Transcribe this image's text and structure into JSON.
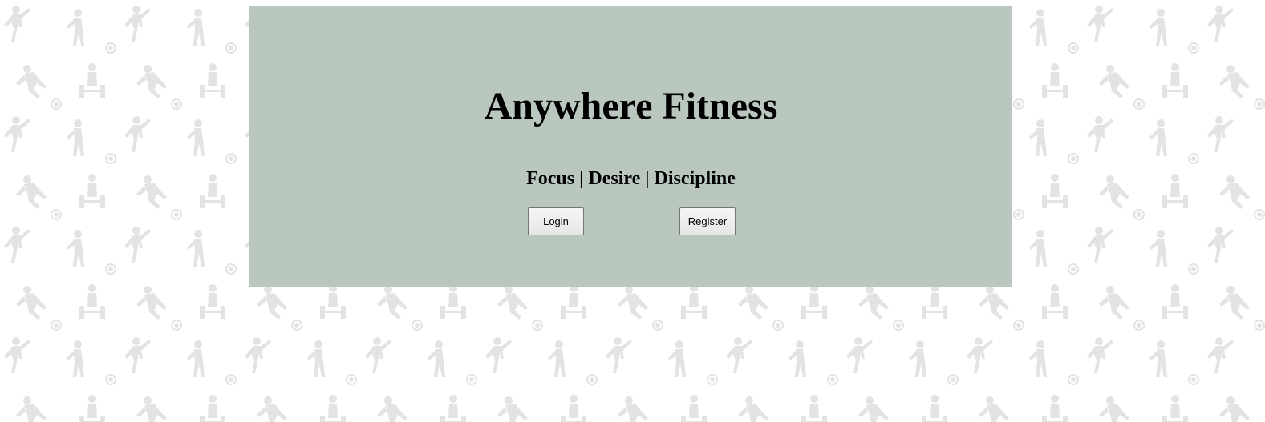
{
  "app": {
    "title": "Anywhere Fitness",
    "tagline": "Focus | Desire | Discipline"
  },
  "actions": {
    "login_label": "Login",
    "register_label": "Register"
  },
  "background": {
    "pattern": "sports-silhouettes",
    "pattern_color": "#e3e3e3",
    "base_color": "#ffffff"
  },
  "colors": {
    "card_background": "#b9c7bf",
    "text": "#000000"
  }
}
